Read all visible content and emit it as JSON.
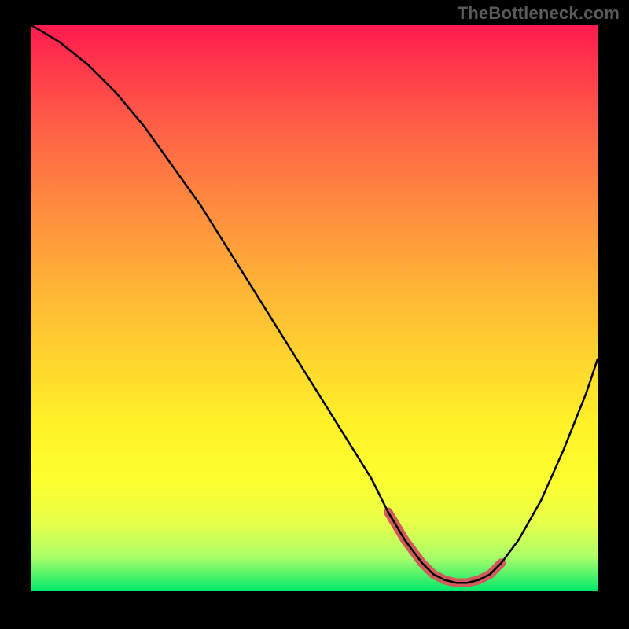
{
  "attribution": "TheBottleneck.com",
  "chart_data": {
    "type": "line",
    "title": "",
    "xlabel": "",
    "ylabel": "",
    "xlim": [
      0,
      100
    ],
    "ylim": [
      0,
      100
    ],
    "series": [
      {
        "name": "main-curve",
        "x": [
          0,
          5,
          10,
          15,
          20,
          25,
          30,
          35,
          40,
          45,
          50,
          55,
          60,
          63,
          66,
          69,
          71,
          73,
          75,
          77,
          79,
          81,
          83,
          86,
          90,
          94,
          98,
          100
        ],
        "y": [
          100,
          97,
          93,
          88,
          82,
          75,
          68,
          60,
          52,
          44,
          36,
          28,
          20,
          14,
          9,
          5,
          3,
          2,
          1.5,
          1.5,
          2,
          3,
          5,
          9,
          16,
          25,
          35,
          41
        ]
      },
      {
        "name": "red-bottom-accent",
        "x": [
          63,
          66,
          69,
          71,
          73,
          75,
          77,
          79,
          81,
          83
        ],
        "y": [
          14,
          9,
          5,
          3,
          2,
          1.5,
          1.5,
          2,
          3,
          5
        ]
      }
    ]
  },
  "colors": {
    "curve": "#000000",
    "accent": "#d15b5b",
    "bg_top": "#ff1a4e",
    "bg_bottom": "#00e86b"
  }
}
